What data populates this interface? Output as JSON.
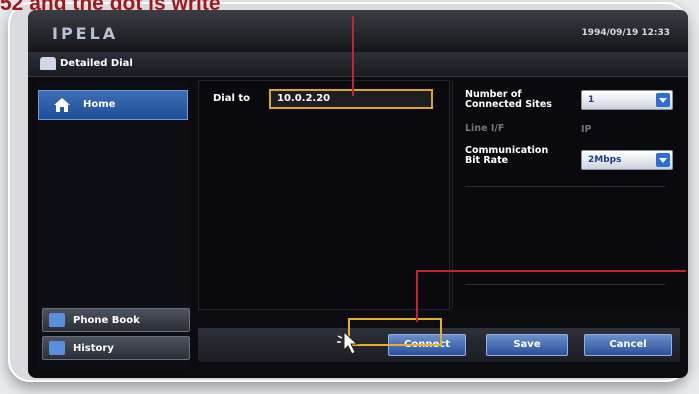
{
  "annotation": {
    "caption": "52 and the dot is write"
  },
  "header": {
    "brand": "IPELA",
    "datetime": "1994/09/19 12:33"
  },
  "window": {
    "title": "Detailed Dial"
  },
  "sidebar": {
    "home_label": "Home",
    "phone_book_label": "Phone Book",
    "history_label": "History"
  },
  "dial": {
    "label": "Dial to",
    "value": "10.0.2.20"
  },
  "settings": {
    "connected_sites_label": "Number of Connected Sites",
    "connected_sites_value": "1",
    "line_if_label": "Line I/F",
    "line_if_value": "IP",
    "bit_rate_label": "Communication Bit Rate",
    "bit_rate_value": "2Mbps"
  },
  "actions": {
    "connect": "Connect",
    "save": "Save",
    "cancel": "Cancel"
  },
  "colors": {
    "accent_highlight": "#e0a32a",
    "annotation_red": "#c2262d",
    "button_blue": "#2a4f9c"
  }
}
